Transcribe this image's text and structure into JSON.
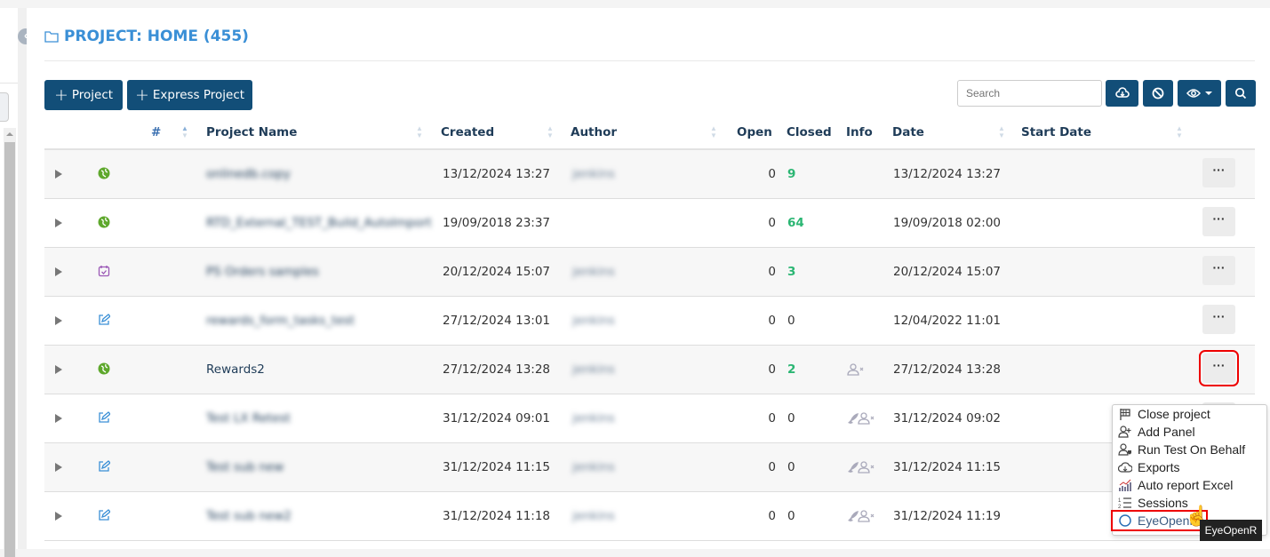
{
  "header": {
    "title": "PROJECT: HOME (455)"
  },
  "toolbar": {
    "add_project": "Project",
    "add_express": "Express Project",
    "search_placeholder": "Search"
  },
  "columns": [
    "#",
    "Project Name",
    "Created",
    "Author",
    "Open",
    "Closed",
    "Info",
    "Date",
    "Start Date"
  ],
  "rows": [
    {
      "type": "globe",
      "name": "onlinedb.copy",
      "created": "13/12/2024 13:27",
      "author": "jenkins",
      "open": "0",
      "closed": "9",
      "info": "",
      "date": "13/12/2024 13:27"
    },
    {
      "type": "globe",
      "name": "RTD_External_TEST_Build_AutoImport",
      "created": "19/09/2018 23:37",
      "author": "",
      "open": "0",
      "closed": "64",
      "info": "",
      "date": "19/09/2018 02:00"
    },
    {
      "type": "calendar",
      "name": "PS Orders samples",
      "created": "20/12/2024 15:07",
      "author": "jenkins",
      "open": "0",
      "closed": "3",
      "info": "",
      "date": "20/12/2024 15:07"
    },
    {
      "type": "edit",
      "name": "rewards_form_tasks_test",
      "created": "27/12/2024 13:01",
      "author": "jenkins",
      "open": "0",
      "closed": "0",
      "info": "",
      "date": "12/04/2022 11:01"
    },
    {
      "type": "globe",
      "name": "Rewards2",
      "created": "27/12/2024 13:28",
      "author": "jenkins",
      "open": "0",
      "closed": "2",
      "info": "user-x",
      "date": "27/12/2024 13:28"
    },
    {
      "type": "edit",
      "name": "Test LX Retest",
      "created": "31/12/2024 09:01",
      "author": "jenkins",
      "open": "0",
      "closed": "0",
      "info": "rocket-user-x",
      "date": "31/12/2024 09:02"
    },
    {
      "type": "edit",
      "name": "Test sub new",
      "created": "31/12/2024 11:15",
      "author": "jenkins",
      "open": "0",
      "closed": "0",
      "info": "rocket-user-x",
      "date": "31/12/2024 11:15"
    },
    {
      "type": "edit",
      "name": "Test sub new2",
      "created": "31/12/2024 11:18",
      "author": "jenkins",
      "open": "0",
      "closed": "0",
      "info": "rocket-user-x",
      "date": "31/12/2024 11:19"
    }
  ],
  "menu": {
    "items": [
      "Close project",
      "Add Panel",
      "Run Test On Behalf",
      "Exports",
      "Auto report Excel",
      "Sessions",
      "EyeOpenR"
    ]
  },
  "tooltip": "EyeOpenR",
  "colors": {
    "primary": "#124e78",
    "title": "#3a8fd6",
    "closed": "#2bb673",
    "highlight": "#e00000"
  }
}
